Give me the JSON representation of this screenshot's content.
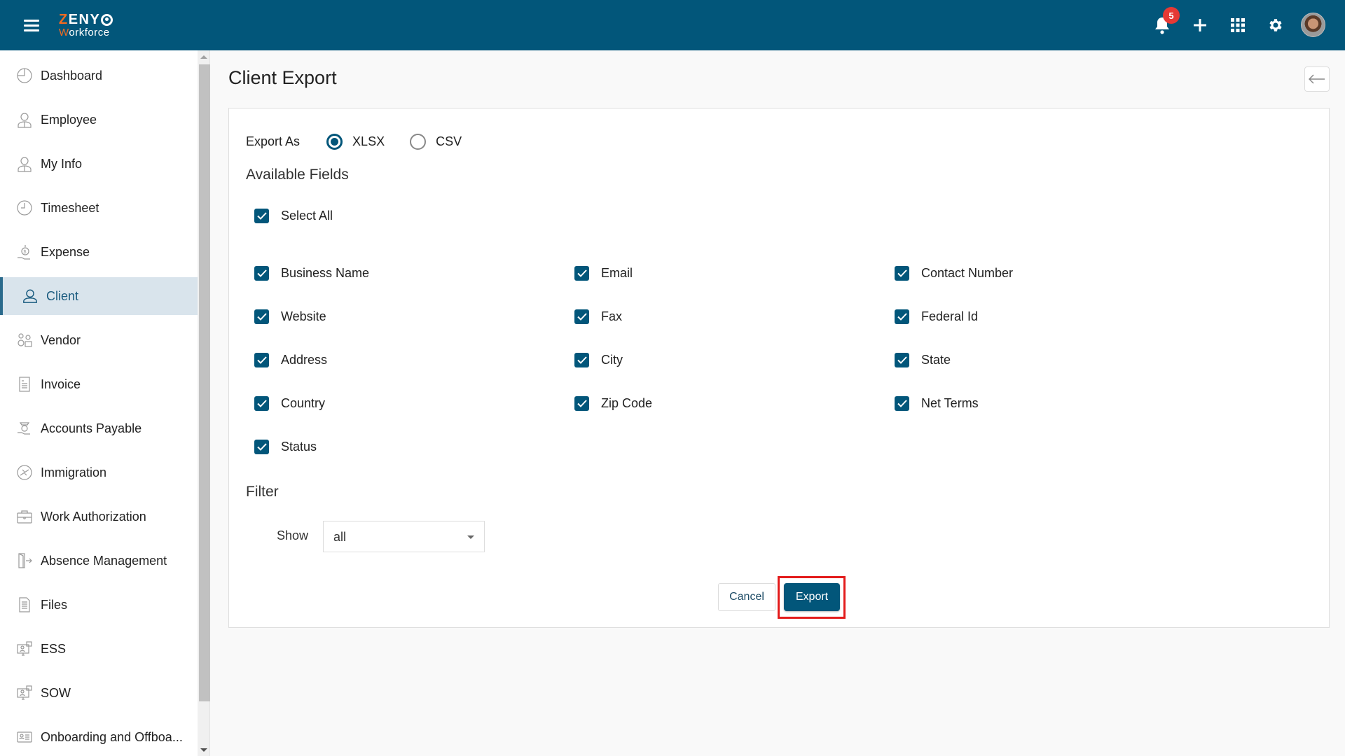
{
  "header": {
    "logo_line1_first": "Z",
    "logo_line1_rest": "ENY",
    "logo_line2_first": "W",
    "logo_line2_rest": "orkforce",
    "notification_count": "5",
    "brand_color": "#02567a",
    "accent_color": "#f26b21"
  },
  "sidebar": {
    "items": [
      {
        "label": "Dashboard",
        "icon": "dashboard-icon"
      },
      {
        "label": "Employee",
        "icon": "employee-icon"
      },
      {
        "label": "My Info",
        "icon": "my-info-icon"
      },
      {
        "label": "Timesheet",
        "icon": "clock-icon"
      },
      {
        "label": "Expense",
        "icon": "expense-icon"
      },
      {
        "label": "Client",
        "icon": "user-icon",
        "active": true
      },
      {
        "label": "Vendor",
        "icon": "vendor-icon"
      },
      {
        "label": "Invoice",
        "icon": "invoice-icon"
      },
      {
        "label": "Accounts Payable",
        "icon": "accounts-payable-icon"
      },
      {
        "label": "Immigration",
        "icon": "immigration-icon"
      },
      {
        "label": "Work Authorization",
        "icon": "briefcase-icon"
      },
      {
        "label": "Absence Management",
        "icon": "door-exit-icon"
      },
      {
        "label": "Files",
        "icon": "file-icon"
      },
      {
        "label": "ESS",
        "icon": "ess-icon"
      },
      {
        "label": "SOW",
        "icon": "sow-icon"
      },
      {
        "label": "Onboarding and Offboa...",
        "icon": "id-card-icon"
      }
    ]
  },
  "page": {
    "title": "Client Export"
  },
  "form": {
    "export_as_label": "Export As",
    "formats": [
      {
        "label": "XLSX",
        "selected": true
      },
      {
        "label": "CSV",
        "selected": false
      }
    ],
    "available_fields_title": "Available Fields",
    "select_all": {
      "label": "Select All",
      "checked": true
    },
    "fields": [
      {
        "label": "Business Name",
        "checked": true
      },
      {
        "label": "Email",
        "checked": true
      },
      {
        "label": "Contact Number",
        "checked": true
      },
      {
        "label": "Website",
        "checked": true
      },
      {
        "label": "Fax",
        "checked": true
      },
      {
        "label": "Federal Id",
        "checked": true
      },
      {
        "label": "Address",
        "checked": true
      },
      {
        "label": "City",
        "checked": true
      },
      {
        "label": "State",
        "checked": true
      },
      {
        "label": "Country",
        "checked": true
      },
      {
        "label": "Zip Code",
        "checked": true
      },
      {
        "label": "Net Terms",
        "checked": true
      },
      {
        "label": "Status",
        "checked": true
      }
    ],
    "filter_title": "Filter",
    "show_label": "Show",
    "show_value": "all",
    "cancel_label": "Cancel",
    "export_label": "Export"
  }
}
